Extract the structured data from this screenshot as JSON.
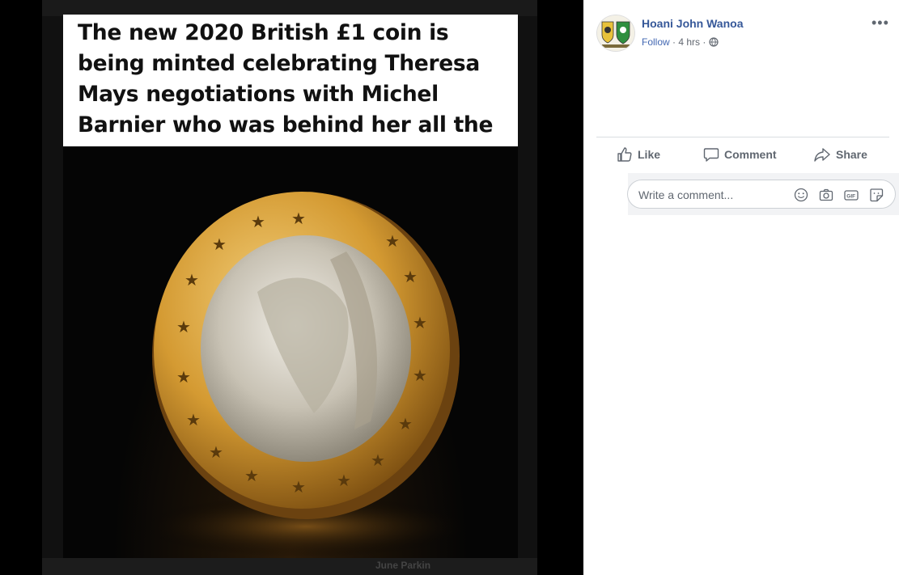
{
  "post_image": {
    "caption": "The new 2020 British £1 coin is being minted celebrating Theresa Mays negotiations with Michel Barnier who was behind her all the way!",
    "bottom_strip_text": "June Parkin"
  },
  "post": {
    "author": "Hoani John Wanoa",
    "follow_label": "Follow",
    "separator": " · ",
    "time": "4 hrs",
    "separator2": " · ",
    "more_label": "•••",
    "privacy_icon": "globe-icon"
  },
  "actions": {
    "like_label": "Like",
    "comment_label": "Comment",
    "share_label": "Share"
  },
  "comment": {
    "placeholder": "Write a comment...",
    "icons": [
      "emoji-icon",
      "camera-icon",
      "gif-icon",
      "sticker-icon"
    ]
  },
  "colors": {
    "link_blue": "#365899",
    "follow_blue": "#4267b2",
    "gold": "#d9a03a"
  }
}
